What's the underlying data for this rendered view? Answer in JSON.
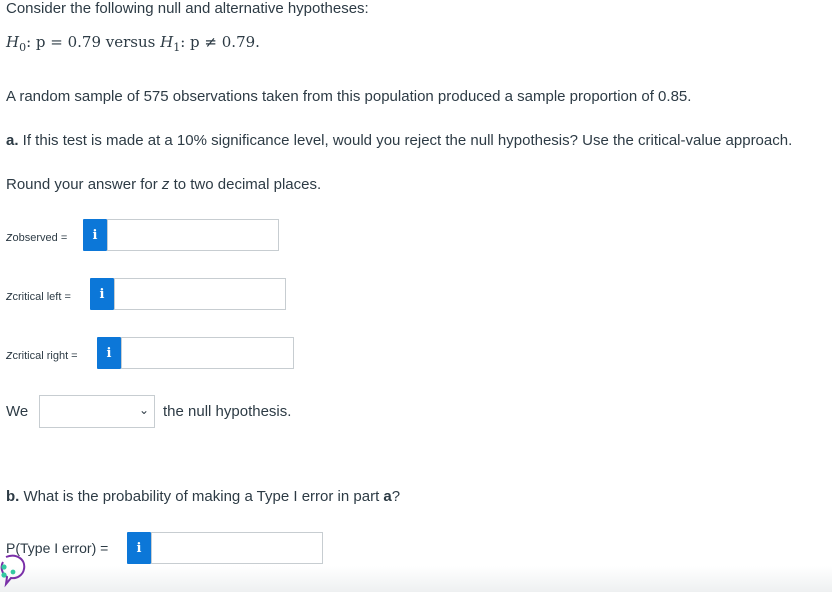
{
  "intro": "Consider the following null and alternative hypotheses:",
  "hypotheses": {
    "h0_label": "H",
    "h0_sub": "0",
    "h0_rest": ": p = 0.79 versus ",
    "h1_label": "H",
    "h1_sub": "1",
    "h1_rest": ": p ≠ 0.79."
  },
  "sample_text": "A random sample of 575 observations taken from this population produced a sample proportion of 0.85.",
  "part_a": {
    "prefix": "a.",
    "question": " If this test is made at a 10% significance level, would you reject the null hypothesis? Use the critical-value approach.",
    "round_note_pre": "Round your answer for ",
    "round_note_var": "z",
    "round_note_post": " to two decimal places."
  },
  "fields": {
    "z_observed": {
      "var": "z",
      "sub": "observed",
      "eq": " =",
      "value": ""
    },
    "z_critical_left": {
      "var": "z",
      "sub": "critical left",
      "eq": " =",
      "value": ""
    },
    "z_critical_right": {
      "var": "z",
      "sub": "critical right",
      "eq": " =",
      "value": ""
    },
    "info_glyph": "i"
  },
  "decision": {
    "prefix": "We",
    "selected": "",
    "suffix": "the null hypothesis.",
    "chevron": "⌄"
  },
  "part_b": {
    "prefix": "b.",
    "question": " What is the probability of making a Type I error in part ",
    "ref": "a",
    "end": "?",
    "label": "P(Type I error) =",
    "value": ""
  },
  "icons": {
    "chat": "chat-bubble-icon",
    "info": "info-icon"
  }
}
